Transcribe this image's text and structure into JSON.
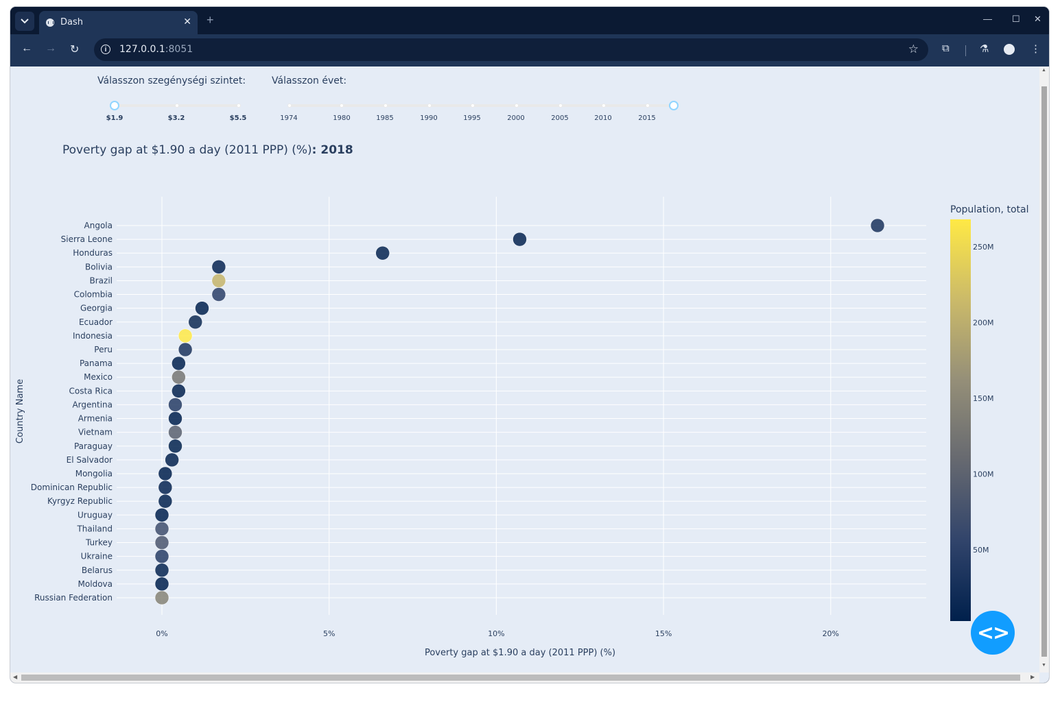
{
  "browser": {
    "tab_title": "Dash",
    "url_host": "127.0.0.1",
    "url_port": ":8051",
    "icons": [
      "tab-search-icon",
      "chart-favicon-icon",
      "close-icon",
      "new-tab-icon",
      "minimize-icon",
      "maximize-icon",
      "window-close-icon",
      "back-icon",
      "forward-icon",
      "reload-icon",
      "site-info-icon",
      "bookmark-star-icon",
      "extensions-icon",
      "labs-flask-icon",
      "profile-icon",
      "more-menu-icon"
    ]
  },
  "controls": {
    "poverty_label": "Válasszon szegénységi szintet:",
    "poverty_marks": [
      "$1.9",
      "$3.2",
      "$5.5"
    ],
    "poverty_selected": "$1.9",
    "year_label": "Válasszon évet:",
    "year_marks": [
      "1974",
      "1980",
      "1985",
      "1990",
      "1995",
      "2000",
      "2005",
      "2010",
      "2015"
    ],
    "year_selected": "2018"
  },
  "heading": {
    "text": "Poverty gap at $1.90 a day (2011 PPP) (%)",
    "sep": ": ",
    "year": "2018"
  },
  "chart_data": {
    "type": "scatter",
    "xlabel": "Poverty gap at $1.90 a day (2011 PPP) (%)",
    "ylabel": "Country Name",
    "xlim": [
      -1.5,
      23.3
    ],
    "x_ticks": [
      0,
      5,
      10,
      15,
      20
    ],
    "x_tick_labels": [
      "0%",
      "5%",
      "10%",
      "15%",
      "20%"
    ],
    "grid": true,
    "colorbar": {
      "title": "Population, total",
      "range": [
        3,
        268
      ],
      "ticks": [
        50,
        100,
        150,
        200,
        250
      ],
      "tick_labels": [
        "50M",
        "100M",
        "150M",
        "200M",
        "250M"
      ],
      "colorscale": [
        "#00204c",
        "#31446b",
        "#666970",
        "#958f78",
        "#cbba69",
        "#ffe945"
      ]
    },
    "points": [
      {
        "country": "Angola",
        "x": 21.4,
        "pop": 31
      },
      {
        "country": "Sierra Leone",
        "x": 10.7,
        "pop": 8
      },
      {
        "country": "Honduras",
        "x": 6.6,
        "pop": 9
      },
      {
        "country": "Bolivia",
        "x": 1.7,
        "pop": 11
      },
      {
        "country": "Brazil",
        "x": 1.7,
        "pop": 209
      },
      {
        "country": "Colombia",
        "x": 1.7,
        "pop": 49
      },
      {
        "country": "Georgia",
        "x": 1.2,
        "pop": 4
      },
      {
        "country": "Ecuador",
        "x": 1.0,
        "pop": 17
      },
      {
        "country": "Indonesia",
        "x": 0.7,
        "pop": 268
      },
      {
        "country": "Peru",
        "x": 0.7,
        "pop": 32
      },
      {
        "country": "Panama",
        "x": 0.5,
        "pop": 4
      },
      {
        "country": "Mexico",
        "x": 0.5,
        "pop": 126
      },
      {
        "country": "Costa Rica",
        "x": 0.5,
        "pop": 5
      },
      {
        "country": "Argentina",
        "x": 0.4,
        "pop": 44
      },
      {
        "country": "Armenia",
        "x": 0.4,
        "pop": 3
      },
      {
        "country": "Vietnam",
        "x": 0.4,
        "pop": 96
      },
      {
        "country": "Paraguay",
        "x": 0.4,
        "pop": 7
      },
      {
        "country": "El Salvador",
        "x": 0.3,
        "pop": 6
      },
      {
        "country": "Mongolia",
        "x": 0.1,
        "pop": 3
      },
      {
        "country": "Dominican Republic",
        "x": 0.1,
        "pop": 11
      },
      {
        "country": "Kyrgyz Republic",
        "x": 0.1,
        "pop": 6
      },
      {
        "country": "Uruguay",
        "x": 0.0,
        "pop": 3
      },
      {
        "country": "Thailand",
        "x": 0.0,
        "pop": 69
      },
      {
        "country": "Turkey",
        "x": 0.0,
        "pop": 82
      },
      {
        "country": "Ukraine",
        "x": 0.0,
        "pop": 45
      },
      {
        "country": "Belarus",
        "x": 0.0,
        "pop": 9
      },
      {
        "country": "Moldova",
        "x": 0.0,
        "pop": 3
      },
      {
        "country": "Russian Federation",
        "x": 0.0,
        "pop": 144
      }
    ]
  }
}
